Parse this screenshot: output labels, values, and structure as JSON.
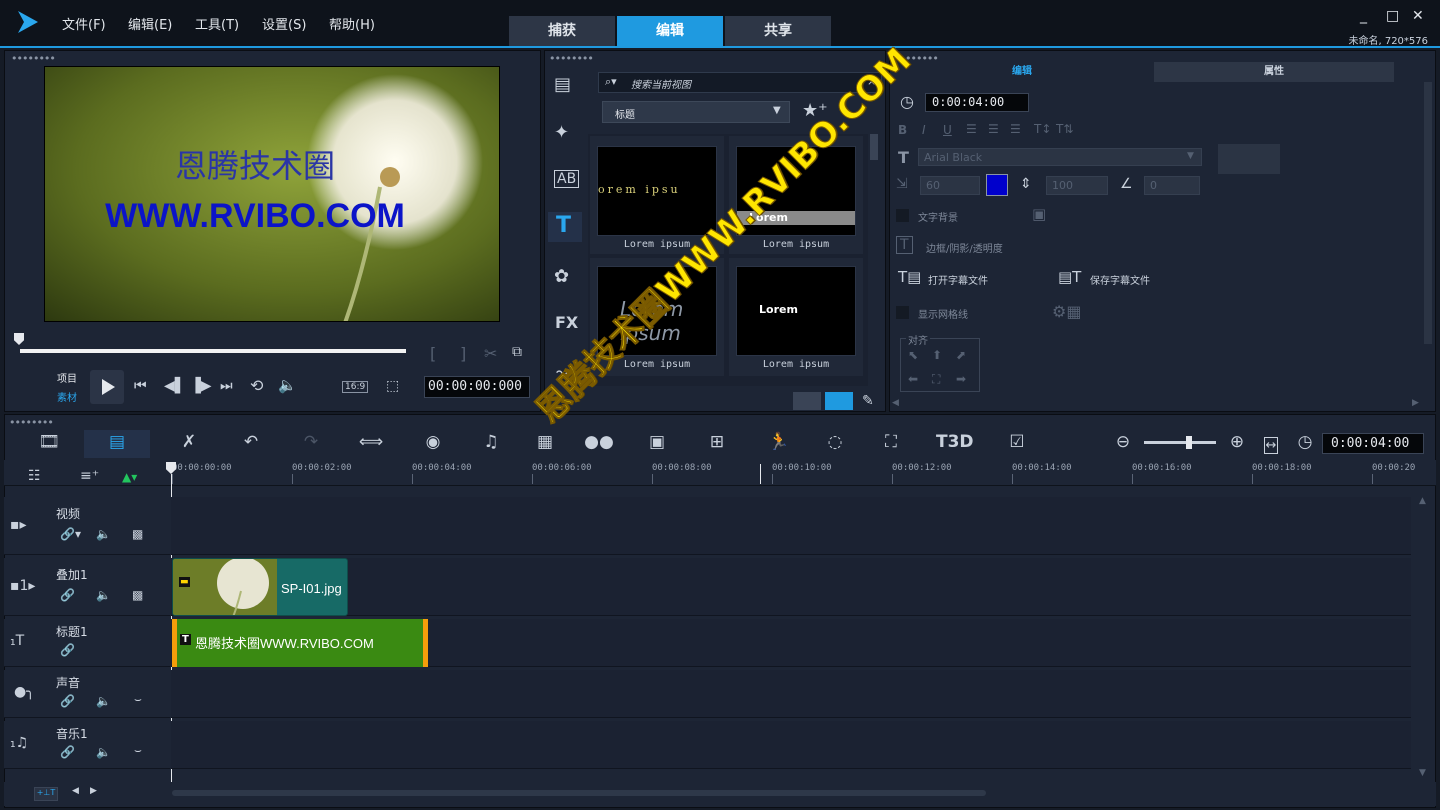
{
  "window": {
    "menu": [
      "文件(F)",
      "编辑(E)",
      "工具(T)",
      "设置(S)",
      "帮助(H)"
    ],
    "tabs": [
      "捕获",
      "编辑",
      "共享"
    ],
    "active_tab": "编辑",
    "controls": [
      "_",
      "□",
      "✕"
    ],
    "project_info": "未命名, 720*576"
  },
  "player": {
    "overlay_text_1": "恩腾技术圈",
    "overlay_text_2": "WWW.RVIBO.COM",
    "mode_project": "项目",
    "mode_clip": "素材",
    "aspect": "16:9",
    "timecode": "00:00:00:000"
  },
  "library": {
    "search_placeholder": "搜索当前视图",
    "category": "标题",
    "items": [
      {
        "preview": "orem ipsu",
        "label": "Lorem ipsum"
      },
      {
        "preview": "Lorem",
        "label": "Lorem ipsum"
      },
      {
        "preview": "Lorem ipsum",
        "label": "Lorem ipsum"
      },
      {
        "preview": "Lorem",
        "label": "Lorem ipsum"
      }
    ]
  },
  "options": {
    "tab_edit": "编辑",
    "tab_props": "属性",
    "duration": "0:00:04:00",
    "font": "Arial Black",
    "size": "60",
    "color": "#0000cc",
    "line_spacing": "100",
    "angle": "0",
    "text_bg": "文字背景",
    "border_shadow": "边框/阴影/透明度",
    "open_subtitle": "打开字幕文件",
    "save_subtitle": "保存字幕文件",
    "show_grid": "显示网格线",
    "align": "对齐"
  },
  "timeline": {
    "zoom_time": "0:00:04:00",
    "ruler": [
      "00:00:00:00",
      "00:00:02:00",
      "00:00:04:00",
      "00:00:06:00",
      "00:00:08:00",
      "00:00:10:00",
      "00:00:12:00",
      "00:00:14:00",
      "00:00:16:00",
      "00:00:18:00",
      "00:00:20"
    ],
    "tracks": [
      {
        "name": "视频",
        "icon": "video-track-icon"
      },
      {
        "name": "叠加1",
        "icon": "overlay-track-icon"
      },
      {
        "name": "标题1",
        "icon": "title-track-icon"
      },
      {
        "name": "声音",
        "icon": "voice-track-icon"
      },
      {
        "name": "音乐1",
        "icon": "music-track-icon"
      }
    ],
    "overlay_clip": "SP-I01.jpg",
    "title_clip": "恩腾技术圈WWW.RVIBO.COM"
  },
  "watermark": {
    "text": "恩腾技术圈WWW.RVIBO.COM",
    "color": "#ffe600"
  }
}
